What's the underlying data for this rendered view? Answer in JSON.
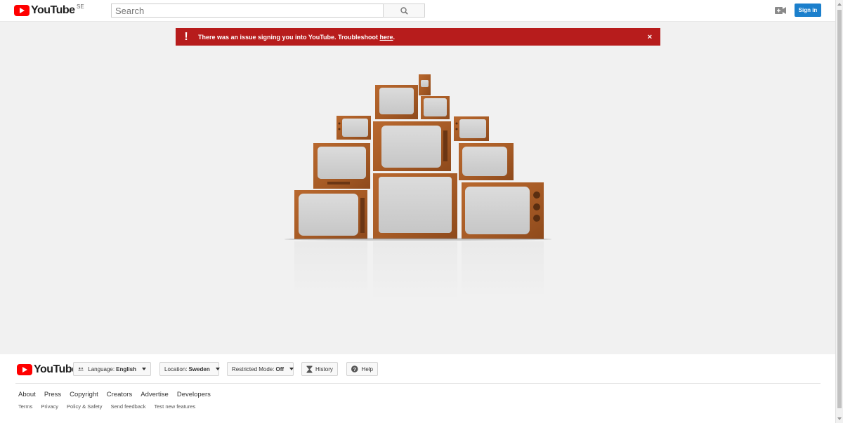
{
  "header": {
    "logo_text": "YouTube",
    "region": "SE",
    "search_placeholder": "Search",
    "signin_label": "Sign in"
  },
  "alert": {
    "message": "There was an issue signing you into YouTube. Troubleshoot ",
    "link": "here",
    "suffix": ".",
    "icon": "!",
    "close": "×"
  },
  "footer": {
    "logo_text": "YouTube",
    "language_label": "Language:",
    "language_value": "English",
    "location_label": "Location:",
    "location_value": "Sweden",
    "restricted_label": "Restricted Mode:",
    "restricted_value": "Off",
    "history_label": "History",
    "help_label": "Help",
    "primary_links": [
      "About",
      "Press",
      "Copyright",
      "Creators",
      "Advertise",
      "Developers"
    ],
    "secondary_links": [
      "Terms",
      "Privacy",
      "Policy & Safety",
      "Send feedback",
      "Test new features"
    ]
  },
  "colors": {
    "brand_red": "#ff0000",
    "alert_red": "#b71c1c",
    "signin_blue": "#1b7fcc"
  },
  "icons": {
    "search": "search-icon",
    "upload": "video-camera-icon",
    "language": "language-people-icon",
    "history": "hourglass-icon",
    "help": "help-icon"
  }
}
